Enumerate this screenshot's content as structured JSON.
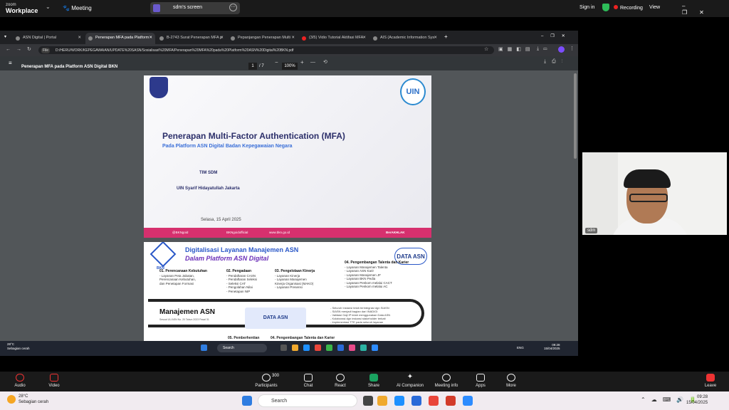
{
  "zoom": {
    "logo_line1": "zoom",
    "logo_line2": "Workplace",
    "meeting_label": "Meeting",
    "share_title": "sdm's screen",
    "sign_in": "Sign in",
    "recording": "Recording",
    "view": "View",
    "toolbar": [
      {
        "name": "audio",
        "label": "Audio"
      },
      {
        "name": "video",
        "label": "Video"
      },
      {
        "name": "participants",
        "label": "Participants",
        "count": "300"
      },
      {
        "name": "chat",
        "label": "Chat"
      },
      {
        "name": "react",
        "label": "React"
      },
      {
        "name": "share",
        "label": "Share"
      },
      {
        "name": "ai-companion",
        "label": "AI Companion"
      },
      {
        "name": "meeting-info",
        "label": "Meeting info"
      },
      {
        "name": "apps",
        "label": "Apps"
      },
      {
        "name": "more",
        "label": "More"
      },
      {
        "name": "leave",
        "label": "Leave"
      }
    ],
    "video_name": "sdm",
    "colors": {
      "recording": "#e22222",
      "shield": "#2ebd59",
      "share": "#1aa260",
      "leave": "#e33333"
    }
  },
  "browser": {
    "tabs": [
      "ASN Digital | Portal",
      "Penerapan MFA pada Platform",
      "B-2743 Surat Penerapan MFA p",
      "Pepanjangan Penerapan Multi",
      "(3/5) Vidio Tutorial Aktifasi MFA",
      "AIS (Academic Information Sys"
    ],
    "file_chip": "File",
    "url": "D:/HERU/WORK/KEPEGAWAIAN/UPDATE%20SASN/Sosialisasi%20MFA/Penerapan%20MFA%20pada%20Platform%20ASN%20Digital%20BKN.pdf"
  },
  "pdf": {
    "title": "Penerapan MFA pada Platform ASN Digital BKN",
    "page": "1",
    "total": "/ 7",
    "zoom": "100%"
  },
  "slide1": {
    "title": "Penerapan Multi-Factor Authentication (MFA)",
    "subtitle": "Pada Platform ASN Digital Badan Kepegawaian Negara",
    "team": "TIM SDM",
    "org": "UIN Syarif Hidayatullah Jakarta",
    "date": "Selasa, 15 April 2025",
    "uin_logo": "UIN",
    "footer": [
      "@BKNgoid",
      "BKNgoidofficial",
      "www.bkn.go.id",
      "BerAKHLAK"
    ]
  },
  "slide2": {
    "title1": "Digitalisasi Layanan Manajemen ASN",
    "title2": "Dalam Platform ASN Digital",
    "data_logo": "DATA ASN",
    "bkn_label": "BKN",
    "col1_head": "01. Perencanaan Kebutuhan",
    "col1": [
      "- Layanan Peta Jabatan,",
      "Perencanaan Kebutuhan,",
      "dan Penetapan Formasi"
    ],
    "col2_head": "02. Pengadaan",
    "col2": [
      "- Pendaftaran CASN",
      "- Pendaftaran Seleksi",
      "- Seleksi CAT",
      "- Pengolahan Nilai",
      "- Penetapan NIP"
    ],
    "col3_head": "03. Pengelolaan Kinerja",
    "col3": [
      "- Layanan Kinerja",
      "- Layanan Manajemen",
      "Kinerja Organisasi (MAKO)",
      "- Layanan Presensi"
    ],
    "col4_head": "04. Pengembangan Talenta dan Karier",
    "col4": [
      "- Layanan Manajemen Talenta",
      "- Layanan ASN Karir",
      "- Layanan Manajemen JF",
      "- Layanan BKN Pedia",
      "- Layanan Penkom melalui CACT",
      "- Layanan Penkom melalui AC"
    ],
    "manajemen": "Manajemen ASN",
    "manajemen_sub": "Sesuai UU ASN No. 20 Tahun 2023 Pasal 31",
    "center_logo": "DATA ASN",
    "right_list": [
      "- Seluruh Instansi telah terintegrasi dgn SIASN",
      "- SIASN menjadi bagian dari INADIGI",
      "- Validasi Gaji IP telah menggunakan Data ASN",
      "- Kolaborasi dgn instansi stakeholder terkait",
      "- Implementasi TTE pada seluruh layanan"
    ],
    "bottom1": "05. Pemberhentian",
    "bottom2": "04. Pengembangan Talenta dan Karier"
  },
  "shared_taskbar": {
    "temp": "28°C",
    "weather": "Sebagian cerah",
    "search": "Search",
    "lang": "ENG",
    "time": "09:28",
    "date": "15/04/2025"
  },
  "taskbar": {
    "temp": "28°C",
    "weather": "Sebagian cerah",
    "search": "Search",
    "time": "09:28",
    "date": "15/04/2025"
  }
}
